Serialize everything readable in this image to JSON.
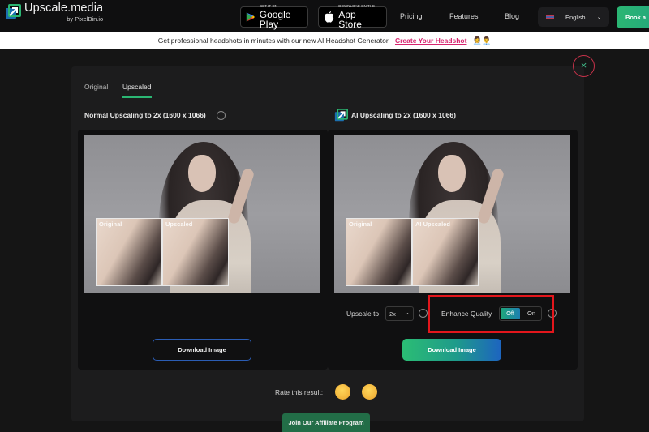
{
  "header": {
    "logo_name": "Upscale.media",
    "logo_by": "by PixelBin.io",
    "google_play": {
      "small": "GET IT ON",
      "big": "Google Play"
    },
    "app_store": {
      "small": "Download on the",
      "big": "App Store"
    },
    "nav": [
      "Pricing",
      "Features",
      "Blog"
    ],
    "language": "English",
    "book_button": "Book a"
  },
  "banner": {
    "text": "Get professional headshots in minutes with our new AI Headshot Generator.",
    "link": "Create Your Headshot",
    "faces": "👩‍💼👨‍💼"
  },
  "modal": {
    "close_icon": "×",
    "tabs": [
      {
        "label": "Original",
        "active": false
      },
      {
        "label": "Upscaled",
        "active": true
      }
    ],
    "left_panel": {
      "title": "Normal Upscaling to 2x (1600 x 1066)",
      "zoom_labels": [
        "Original",
        "Upscaled"
      ],
      "download_label": "Download Image"
    },
    "right_panel": {
      "title": "AI Upscaling to 2x (1600 x 1066)",
      "zoom_labels": [
        "Original",
        "AI Upscaled"
      ],
      "upscale_label": "Upscale to",
      "upscale_value": "2x",
      "enhance_label": "Enhance Quality",
      "toggle_off": "Off",
      "toggle_on": "On",
      "toggle_state": "Off",
      "download_label": "Download Image"
    },
    "rate_label": "Rate this result:",
    "emojis": {
      "sad": "😔",
      "happy": "😀"
    }
  },
  "affiliate_button": "Join Our Affiliate Program",
  "colors": {
    "accent_green": "#2bb673",
    "accent_blue": "#1d64c0",
    "highlight_red": "#e3161c",
    "banner_link": "#d6246e"
  }
}
